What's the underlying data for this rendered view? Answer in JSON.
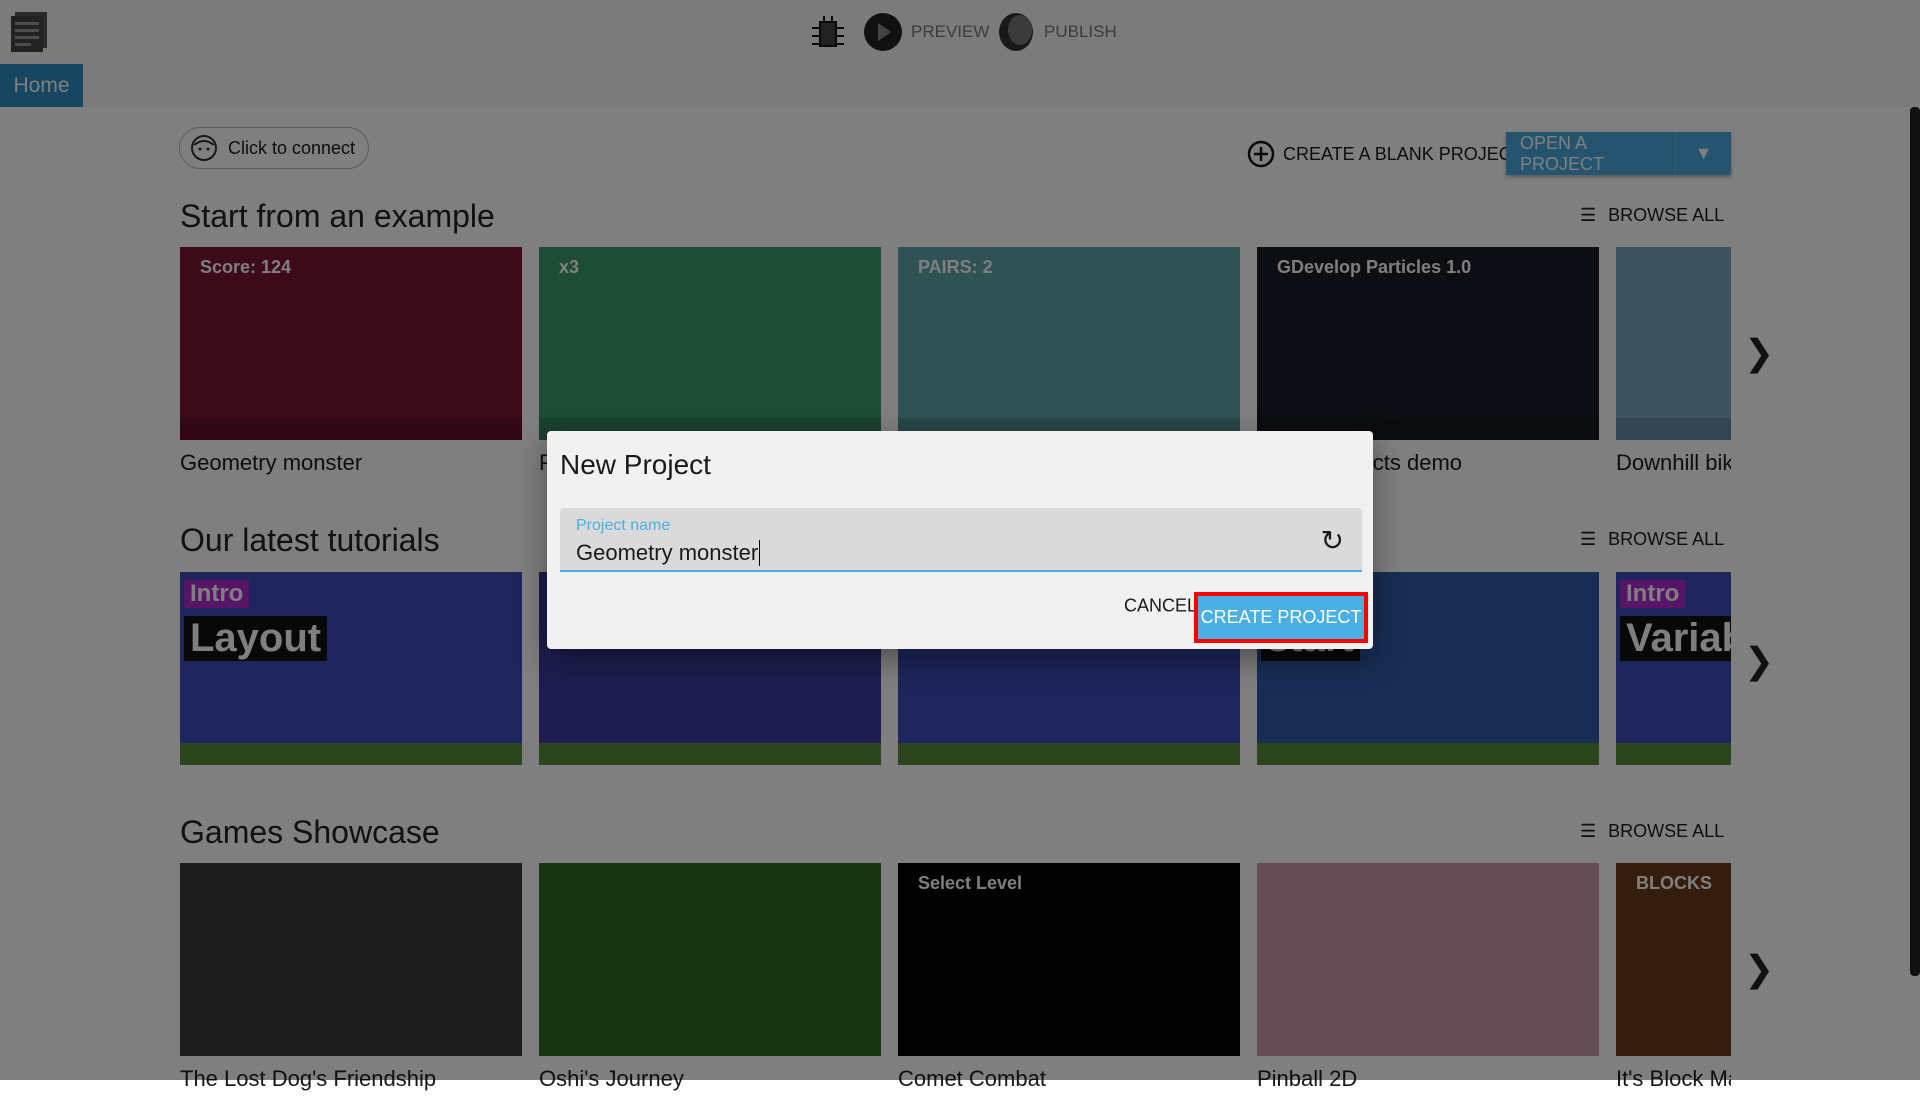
{
  "topbar": {
    "home_tab": "Home",
    "preview": "PREVIEW",
    "publish": "PUBLISH"
  },
  "header": {
    "connect": "Click to connect",
    "create_blank": "CREATE A BLANK PROJECT",
    "open_project": "OPEN A PROJECT"
  },
  "sections": [
    {
      "title": "Start from an example",
      "browse": "BROWSE ALL",
      "cards": [
        {
          "caption": "Geometry monster",
          "color": "#7a1535",
          "text": "Score: 124"
        },
        {
          "caption": "Platformer",
          "color": "#3c9a6c",
          "text": "x3"
        },
        {
          "caption": "",
          "color": "#5ea7aa",
          "text": "PAIRS: 2"
        },
        {
          "caption": "Particle effects demo",
          "color": "#1b1d27",
          "text": "GDevelop Particles 1.0"
        },
        {
          "caption": "Downhill bike",
          "color": "#7aa6bf",
          "text": ""
        }
      ]
    },
    {
      "title": "Our latest tutorials",
      "browse": "BROWSE ALL",
      "cards": [
        {
          "caption": "",
          "color": "#3a4ab8",
          "text": "Layout",
          "tag": "Intro"
        },
        {
          "caption": "",
          "color": "#3a3aa0",
          "text": "",
          "tag": ""
        },
        {
          "caption": "",
          "color": "#3a4ab8",
          "text": "",
          "tag": ""
        },
        {
          "caption": "",
          "color": "#2f5aa8",
          "text": "start",
          "tag": ""
        },
        {
          "caption": "",
          "color": "#3a4ab8",
          "text": "Variab",
          "tag": "Intro"
        }
      ]
    },
    {
      "title": "Games Showcase",
      "browse": "BROWSE ALL",
      "cards": [
        {
          "caption": "The Lost Dog's Friendship",
          "color": "#3a3a3a",
          "text": ""
        },
        {
          "caption": "Oshi's Journey",
          "color": "#2e6a1e",
          "text": ""
        },
        {
          "caption": "Comet Combat",
          "color": "#050505",
          "text": "Select Level"
        },
        {
          "caption": "Pinball 2D",
          "color": "#c89aa8",
          "text": ""
        },
        {
          "caption": "It's Block Ma",
          "color": "#6a3a1a",
          "text": "BLOCKS"
        }
      ]
    }
  ],
  "dialog": {
    "title": "New Project",
    "field_label": "Project name",
    "field_value": "Geometry monster",
    "cancel": "CANCEL",
    "create": "CREATE PROJECT"
  },
  "colors": {
    "accent": "#4ab0e4",
    "highlight": "#ff0000"
  }
}
